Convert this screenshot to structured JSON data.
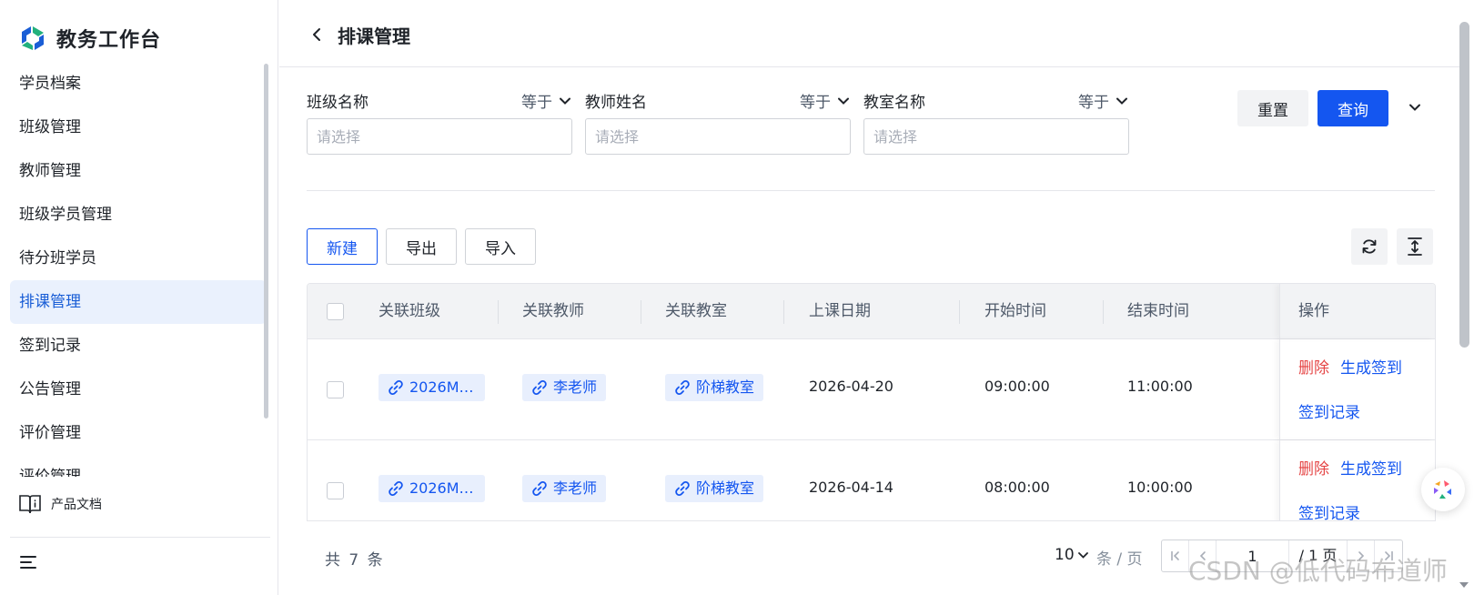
{
  "app": {
    "title": "教务工作台"
  },
  "sidebar": {
    "items": [
      {
        "label": "学员档案",
        "active": false
      },
      {
        "label": "班级管理",
        "active": false
      },
      {
        "label": "教师管理",
        "active": false
      },
      {
        "label": "班级学员管理",
        "active": false
      },
      {
        "label": "待分班学员",
        "active": false
      },
      {
        "label": "排课管理",
        "active": true
      },
      {
        "label": "签到记录",
        "active": false
      },
      {
        "label": "公告管理",
        "active": false
      },
      {
        "label": "评价管理",
        "active": false
      },
      {
        "label": "评价管理",
        "active": false
      }
    ],
    "docs_label": "产品文档"
  },
  "header": {
    "title": "排课管理"
  },
  "filters": [
    {
      "label": "班级名称",
      "operator": "等于",
      "placeholder": "请选择"
    },
    {
      "label": "教师姓名",
      "operator": "等于",
      "placeholder": "请选择"
    },
    {
      "label": "教室名称",
      "operator": "等于",
      "placeholder": "请选择"
    }
  ],
  "actions": {
    "reset": "重置",
    "query": "查询"
  },
  "toolbar": {
    "new": "新建",
    "export": "导出",
    "import": "导入"
  },
  "table": {
    "columns": [
      "关联班级",
      "关联教师",
      "关联教室",
      "上课日期",
      "开始时间",
      "结束时间",
      "操作"
    ],
    "rows": [
      {
        "class": "2026M…",
        "teacher": "李老师",
        "room": "阶梯教室",
        "date": "2026-04-20",
        "start": "09:00:00",
        "end": "11:00:00"
      },
      {
        "class": "2026M…",
        "teacher": "李老师",
        "room": "阶梯教室",
        "date": "2026-04-14",
        "start": "08:00:00",
        "end": "10:00:00"
      }
    ],
    "row_actions": {
      "delete": "删除",
      "generate": "生成签到",
      "records": "签到记录"
    }
  },
  "pagination": {
    "total_text": "共 7 条",
    "page_size": "10",
    "per_page_label": "条 / 页",
    "current_page": "1",
    "total_pages_text": "/ 1 页"
  },
  "watermark": "CSDN @低代码布道师",
  "colors": {
    "primary": "#1456f0",
    "danger": "#e54545",
    "active_bg": "#eaf1fd"
  }
}
